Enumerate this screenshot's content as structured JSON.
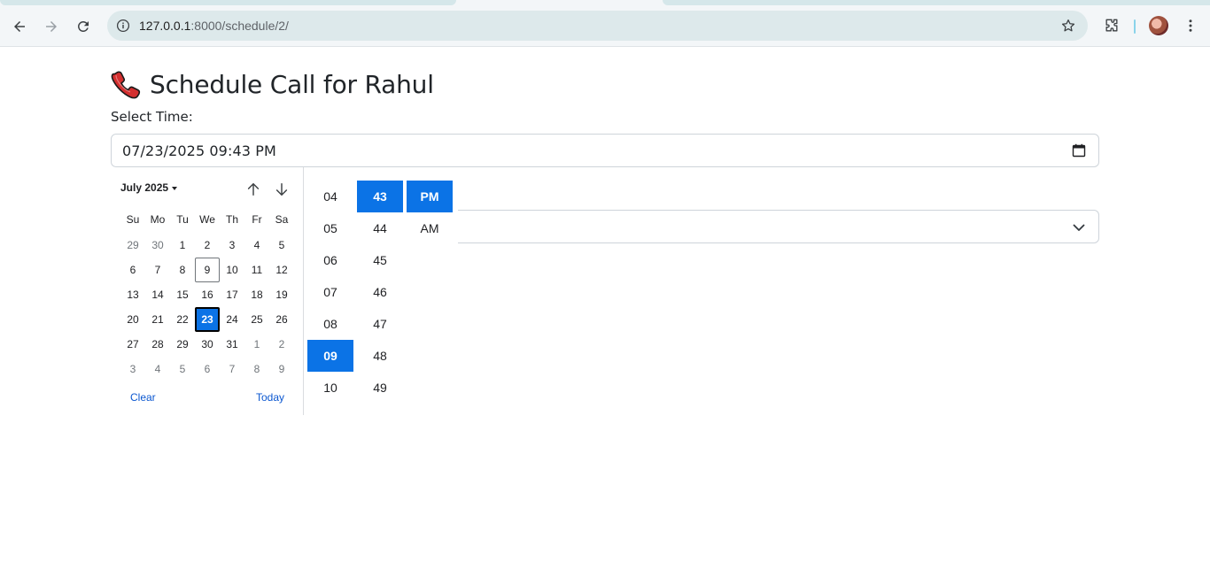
{
  "browser": {
    "url_host": "127.0.0.1",
    "url_path": ":8000/schedule/2/",
    "icons": [
      "back-icon",
      "forward-icon",
      "reload-icon",
      "site-info-icon",
      "bookmark-star-icon",
      "extensions-icon",
      "profile-avatar",
      "kebab-menu-icon"
    ]
  },
  "page": {
    "title": "Schedule Call for Rahul",
    "title_icon": "telephone-receiver-icon",
    "time_label": "Select Time:",
    "datetime_value": "07/23/2025 09:43  PM"
  },
  "picker": {
    "month_label": "July 2025",
    "weekdays": [
      "Su",
      "Mo",
      "Tu",
      "We",
      "Th",
      "Fr",
      "Sa"
    ],
    "days": [
      {
        "d": "29",
        "other": true
      },
      {
        "d": "30",
        "other": true
      },
      {
        "d": "1"
      },
      {
        "d": "2"
      },
      {
        "d": "3"
      },
      {
        "d": "4"
      },
      {
        "d": "5"
      },
      {
        "d": "6"
      },
      {
        "d": "7"
      },
      {
        "d": "8"
      },
      {
        "d": "9",
        "today": true
      },
      {
        "d": "10"
      },
      {
        "d": "11"
      },
      {
        "d": "12"
      },
      {
        "d": "13"
      },
      {
        "d": "14"
      },
      {
        "d": "15"
      },
      {
        "d": "16"
      },
      {
        "d": "17"
      },
      {
        "d": "18"
      },
      {
        "d": "19"
      },
      {
        "d": "20"
      },
      {
        "d": "21"
      },
      {
        "d": "22"
      },
      {
        "d": "23",
        "selected": true
      },
      {
        "d": "24"
      },
      {
        "d": "25"
      },
      {
        "d": "26"
      },
      {
        "d": "27"
      },
      {
        "d": "28"
      },
      {
        "d": "29"
      },
      {
        "d": "30"
      },
      {
        "d": "31"
      },
      {
        "d": "1",
        "other": true
      },
      {
        "d": "2",
        "other": true
      },
      {
        "d": "3",
        "other": true
      },
      {
        "d": "4",
        "other": true
      },
      {
        "d": "5",
        "other": true
      },
      {
        "d": "6",
        "other": true
      },
      {
        "d": "7",
        "other": true
      },
      {
        "d": "8",
        "other": true
      },
      {
        "d": "9",
        "other": true
      }
    ],
    "clear_label": "Clear",
    "today_label": "Today",
    "hours": [
      "04",
      "05",
      "06",
      "07",
      "08",
      "09",
      "10"
    ],
    "selected_hour": "09",
    "minutes": [
      "43",
      "44",
      "45",
      "46",
      "47",
      "48",
      "49"
    ],
    "selected_minute": "43",
    "meridiem": [
      "PM",
      "AM"
    ],
    "selected_meridiem": "PM"
  },
  "colors": {
    "accent": "#0b73e6",
    "link": "#0b57d0"
  }
}
